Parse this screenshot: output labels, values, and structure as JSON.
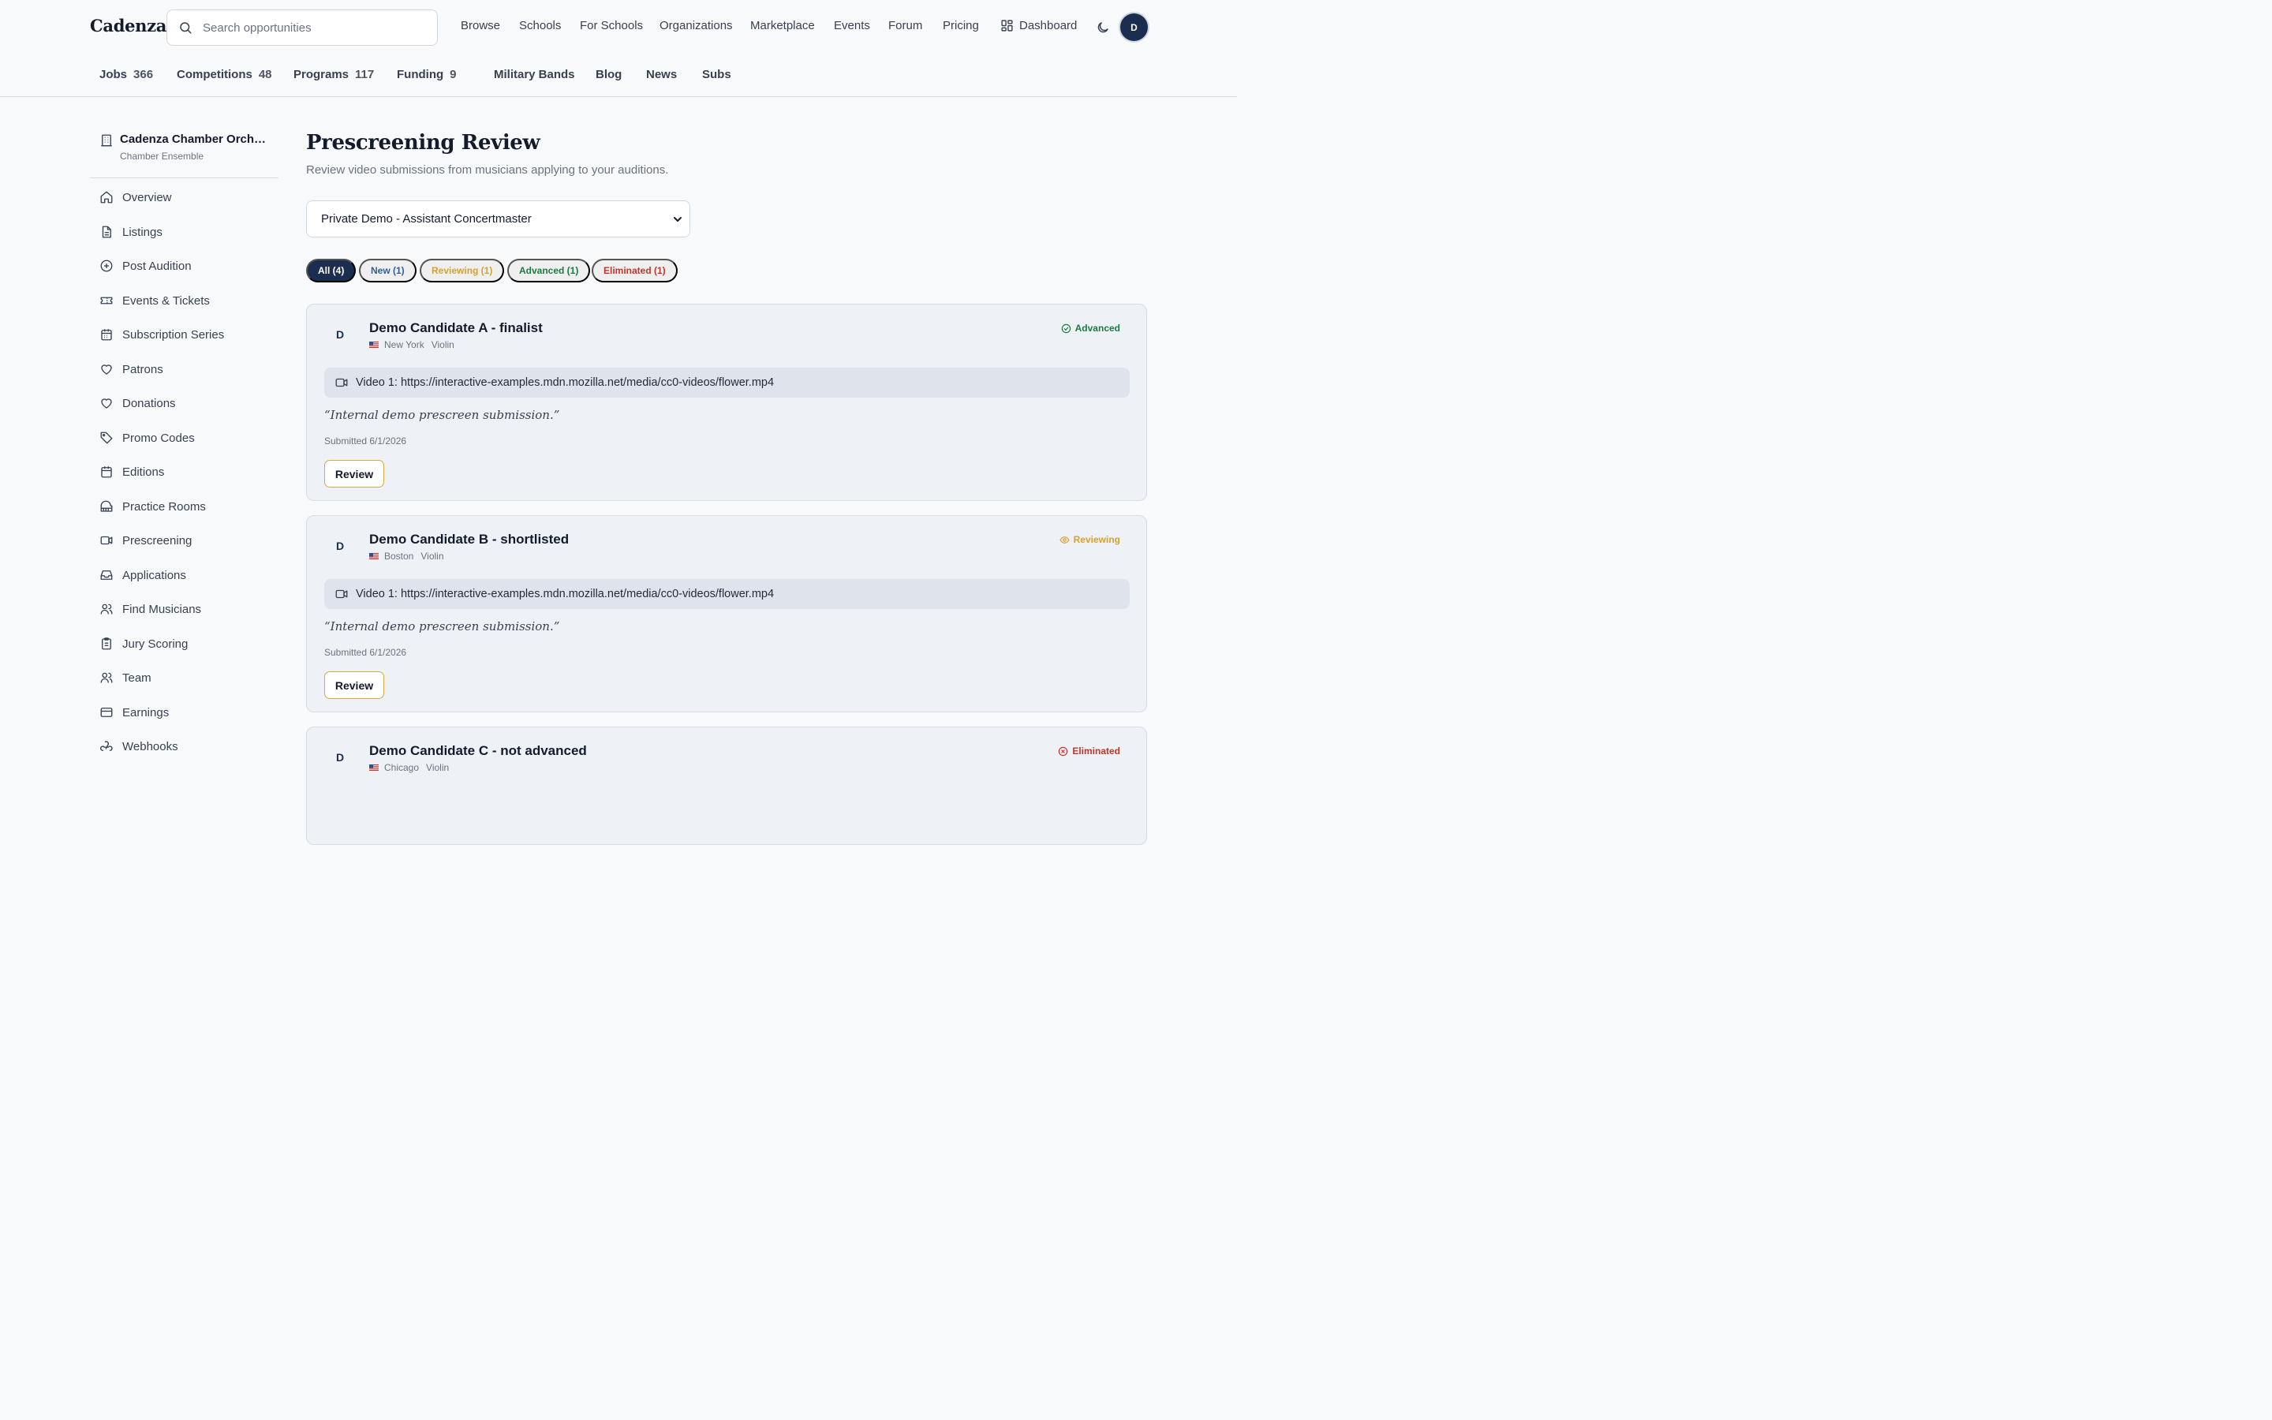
{
  "header": {
    "logo": "Cadenza",
    "search_placeholder": "Search opportunities",
    "nav": [
      "Browse",
      "Schools",
      "For Schools",
      "Organizations",
      "Marketplace",
      "Events",
      "Forum",
      "Pricing"
    ],
    "dashboard": "Dashboard",
    "avatar": "D"
  },
  "subnav": {
    "jobs": {
      "label": "Jobs",
      "count": "366"
    },
    "competitions": {
      "label": "Competitions",
      "count": "48"
    },
    "programs": {
      "label": "Programs",
      "count": "117"
    },
    "funding": {
      "label": "Funding",
      "count": "9"
    },
    "links": [
      "Military Bands",
      "Blog",
      "News",
      "Subs"
    ]
  },
  "sidebar": {
    "org_name": "Cadenza Chamber Orchestra",
    "org_type": "Chamber Ensemble",
    "items": [
      {
        "label": "Overview",
        "icon": "home-icon"
      },
      {
        "label": "Listings",
        "icon": "document-icon"
      },
      {
        "label": "Post Audition",
        "icon": "plus-circle-icon"
      },
      {
        "label": "Events & Tickets",
        "icon": "ticket-icon"
      },
      {
        "label": "Subscription Series",
        "icon": "calendar-icon"
      },
      {
        "label": "Patrons",
        "icon": "heart-icon"
      },
      {
        "label": "Donations",
        "icon": "heart-icon"
      },
      {
        "label": "Promo Codes",
        "icon": "tag-icon"
      },
      {
        "label": "Editions",
        "icon": "calendar-icon"
      },
      {
        "label": "Practice Rooms",
        "icon": "piano-icon"
      },
      {
        "label": "Prescreening",
        "icon": "video-icon"
      },
      {
        "label": "Applications",
        "icon": "inbox-icon"
      },
      {
        "label": "Find Musicians",
        "icon": "users-icon"
      },
      {
        "label": "Jury Scoring",
        "icon": "clipboard-icon"
      },
      {
        "label": "Team",
        "icon": "users-icon"
      },
      {
        "label": "Earnings",
        "icon": "credit-card-icon"
      },
      {
        "label": "Webhooks",
        "icon": "webhook-icon"
      }
    ]
  },
  "main": {
    "title": "Prescreening Review",
    "subtitle": "Review video submissions from musicians applying to your auditions.",
    "audition_select": "Private Demo - Assistant Concertmaster",
    "filters": [
      {
        "label": "All (4)",
        "color": "#ffffff"
      },
      {
        "label": "New (1)",
        "color": "#2f5f9e"
      },
      {
        "label": "Reviewing (1)",
        "color": "#d4a233"
      },
      {
        "label": "Advanced (1)",
        "color": "#1e7a42"
      },
      {
        "label": "Eliminated (1)",
        "color": "#c0362c"
      }
    ],
    "cards": [
      {
        "avatar": "D",
        "name": "Demo Candidate A - finalist",
        "city": "New York",
        "instrument": "Violin",
        "status": "Advanced",
        "status_color": "#1e7a42",
        "video": "Video 1: https://interactive-examples.mdn.mozilla.net/media/cc0-videos/flower.mp4",
        "note": "“Internal demo prescreen submission.”",
        "submitted": "Submitted 6/1/2026",
        "review_label": "Review"
      },
      {
        "avatar": "D",
        "name": "Demo Candidate B - shortlisted",
        "city": "Boston",
        "instrument": "Violin",
        "status": "Reviewing",
        "status_color": "#d4a233",
        "video": "Video 1: https://interactive-examples.mdn.mozilla.net/media/cc0-videos/flower.mp4",
        "note": "“Internal demo prescreen submission.”",
        "submitted": "Submitted 6/1/2026",
        "review_label": "Review"
      },
      {
        "avatar": "D",
        "name": "Demo Candidate C - not advanced",
        "city": "Chicago",
        "instrument": "Violin",
        "status": "Eliminated",
        "status_color": "#c0362c"
      }
    ]
  }
}
